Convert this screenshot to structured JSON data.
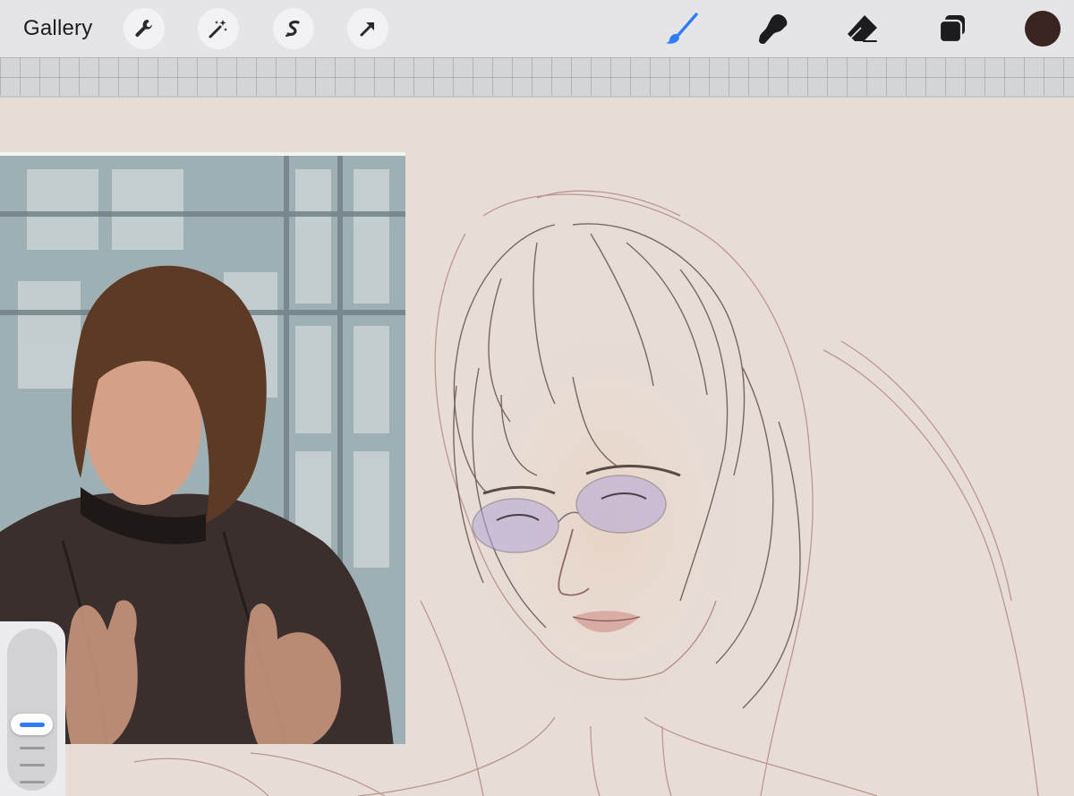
{
  "toolbar": {
    "gallery_label": "Gallery",
    "left_tools": [
      {
        "name": "actions",
        "icon": "wrench-icon"
      },
      {
        "name": "adjustments",
        "icon": "magic-wand-icon"
      },
      {
        "name": "selection",
        "icon": "selection-s-icon"
      },
      {
        "name": "transform",
        "icon": "arrow-cursor-icon"
      }
    ],
    "right_tools": [
      {
        "name": "brush",
        "icon": "brush-icon",
        "active": true
      },
      {
        "name": "smudge",
        "icon": "smudge-icon",
        "active": false
      },
      {
        "name": "eraser",
        "icon": "eraser-icon",
        "active": false
      },
      {
        "name": "layers",
        "icon": "layers-icon",
        "active": false
      }
    ],
    "current_color": "#3a2420"
  },
  "colors": {
    "active_tool": "#2f7cf6",
    "inactive_tool": "#1c1c1e",
    "canvas_background": "#e7ddd6",
    "sketch_line": "#a97f78",
    "pencil_line": "#5a4a46",
    "glasses_tint": "#b3a7d8"
  },
  "sidebar": {
    "size_slider_level": 0.55,
    "thumb_color": "#2f7cf6"
  }
}
